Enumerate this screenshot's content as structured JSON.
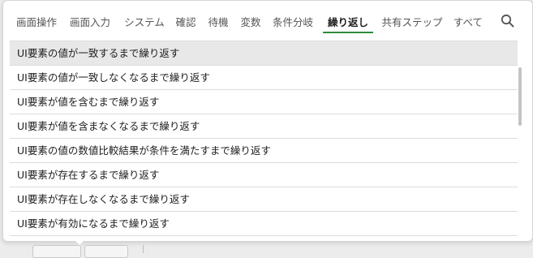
{
  "tabs": [
    {
      "label": "画面操作",
      "active": false
    },
    {
      "label": "画面入力",
      "active": false
    },
    {
      "label": "システム",
      "active": false
    },
    {
      "label": "確認",
      "active": false
    },
    {
      "label": "待機",
      "active": false
    },
    {
      "label": "変数",
      "active": false
    },
    {
      "label": "条件分岐",
      "active": false
    },
    {
      "label": "繰り返し",
      "active": true
    },
    {
      "label": "共有ステップ",
      "active": false
    },
    {
      "label": "すべて",
      "active": false
    }
  ],
  "search": {
    "icon": "search-icon"
  },
  "items": [
    {
      "label": "UI要素の値が一致するまで繰り返す",
      "selected": true
    },
    {
      "label": "UI要素の値が一致しなくなるまで繰り返す",
      "selected": false
    },
    {
      "label": "UI要素が値を含むまで繰り返す",
      "selected": false
    },
    {
      "label": "UI要素が値を含まなくなるまで繰り返す",
      "selected": false
    },
    {
      "label": "UI要素の値の数値比較結果が条件を満たすまで繰り返す",
      "selected": false
    },
    {
      "label": "UI要素が存在するまで繰り返す",
      "selected": false
    },
    {
      "label": "UI要素が存在しなくなるまで繰り返す",
      "selected": false
    },
    {
      "label": "UI要素が有効になるまで繰り返す",
      "selected": false
    }
  ],
  "colors": {
    "accent": "#2e8b3a",
    "selected_row": "#e8e8e8",
    "divider": "#dcdcdc"
  }
}
